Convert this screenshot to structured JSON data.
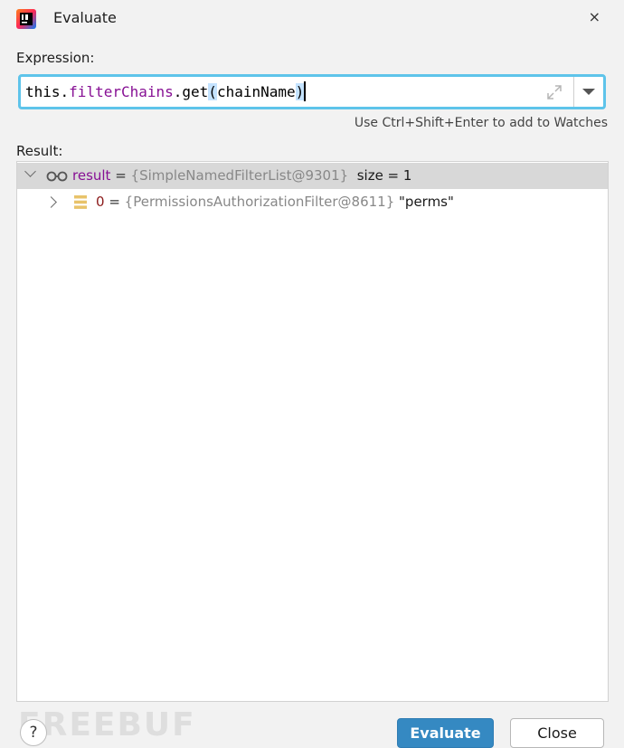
{
  "window": {
    "title": "Evaluate",
    "close_glyph": "×",
    "app_icon": "intellij-idea-icon"
  },
  "expression": {
    "label": "Expression:",
    "parts": {
      "p1": "this.",
      "p2": "filterChains",
      "p3": ".get",
      "p4": "(",
      "p5": "chainName",
      "p6": ")"
    },
    "expand_icon": "expand-icon",
    "dropdown_icon": "chevron-down-icon"
  },
  "hint": "Use Ctrl+Shift+Enter to add to Watches",
  "result": {
    "label": "Result:",
    "rows": [
      {
        "name": "result",
        "eq": " = ",
        "type": "{SimpleNamedFilterList@9301}",
        "value": "  size = 1",
        "icon": "watch-glasses-icon",
        "expanded": true
      },
      {
        "name": "0",
        "eq": " = ",
        "type": "{PermissionsAuthorizationFilter@8611}",
        "value": " \"perms\"",
        "icon": "list-element-icon",
        "expanded": false
      }
    ]
  },
  "watermark": "FREEBUF",
  "buttons": {
    "help": "?",
    "evaluate": "Evaluate",
    "close": "Close"
  },
  "colors": {
    "accent": "#5ec4ea",
    "primary_button": "#3589c2",
    "field_name": "#871094",
    "type_text": "#888888"
  }
}
